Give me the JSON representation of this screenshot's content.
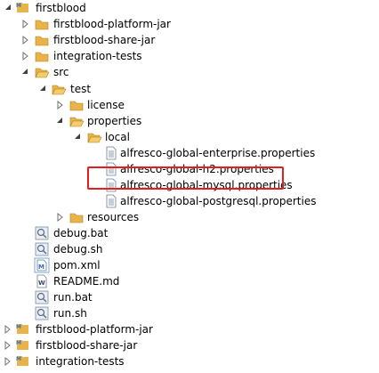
{
  "tree": {
    "root": "firstblood",
    "root_children": [
      "firstblood-platform-jar",
      "firstblood-share-jar",
      "integration-tests",
      "src"
    ],
    "test": "test",
    "license": "license",
    "properties": "properties",
    "local": "local",
    "local_files": [
      "alfresco-global-enterprise.properties",
      "alfresco-global-h2.properties",
      "alfresco-global-mysql.properties",
      "alfresco-global-postgresql.properties"
    ],
    "resources": "resources",
    "root_files": [
      "debug.bat",
      "debug.sh",
      "pom.xml",
      "README.md",
      "run.bat",
      "run.sh"
    ],
    "projects": [
      "firstblood-platform-jar",
      "firstblood-share-jar",
      "integration-tests"
    ]
  },
  "colors": {
    "highlight_border": "#e0201e",
    "folder": "#e8b449",
    "project_blue": "#3b6fb6"
  }
}
